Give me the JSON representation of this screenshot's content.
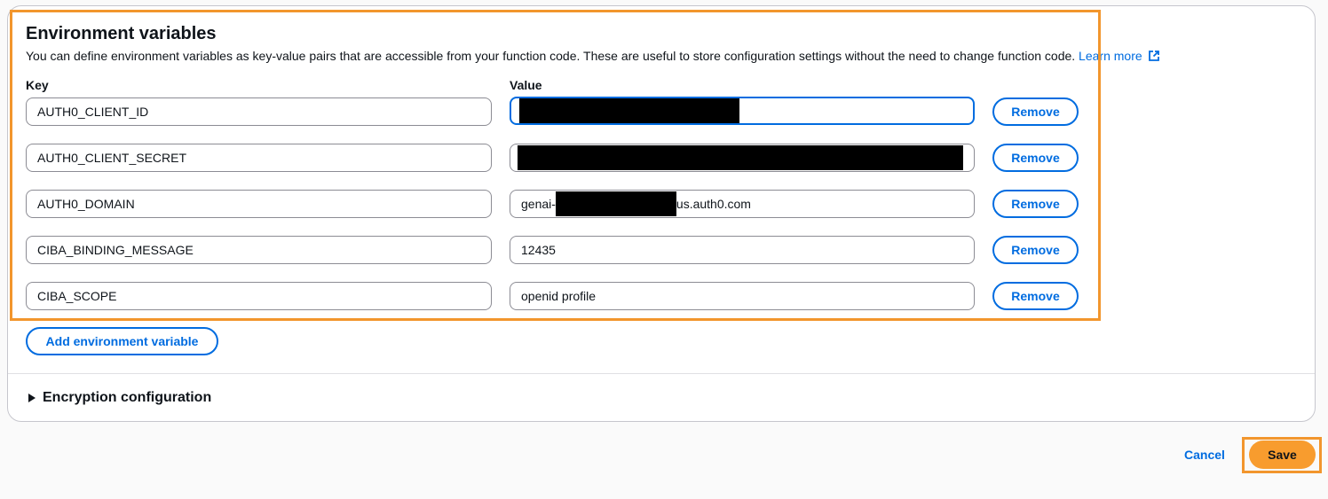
{
  "section": {
    "title": "Environment variables",
    "description": "You can define environment variables as key-value pairs that are accessible from your function code. These are useful to store configuration settings without the need to change function code.",
    "learn_more": "Learn more",
    "key_label": "Key",
    "value_label": "Value",
    "remove_label": "Remove",
    "add_label": "Add environment variable"
  },
  "variables": [
    {
      "key": "AUTH0_CLIENT_ID",
      "value": "",
      "value_prefix": "",
      "value_suffix": ""
    },
    {
      "key": "AUTH0_CLIENT_SECRET",
      "value": "",
      "value_prefix": "",
      "value_suffix": ""
    },
    {
      "key": "AUTH0_DOMAIN",
      "value": "",
      "value_prefix": "genai-",
      "value_suffix": "us.auth0.com"
    },
    {
      "key": "CIBA_BINDING_MESSAGE",
      "value": "12435",
      "value_prefix": "",
      "value_suffix": ""
    },
    {
      "key": "CIBA_SCOPE",
      "value": "openid profile",
      "value_prefix": "",
      "value_suffix": ""
    }
  ],
  "encryption": {
    "label": "Encryption configuration"
  },
  "footer": {
    "cancel_label": "Cancel",
    "save_label": "Save"
  },
  "colors": {
    "accent": "#006ce0",
    "highlight": "#f2962d",
    "save_bg": "#f89c2e"
  }
}
